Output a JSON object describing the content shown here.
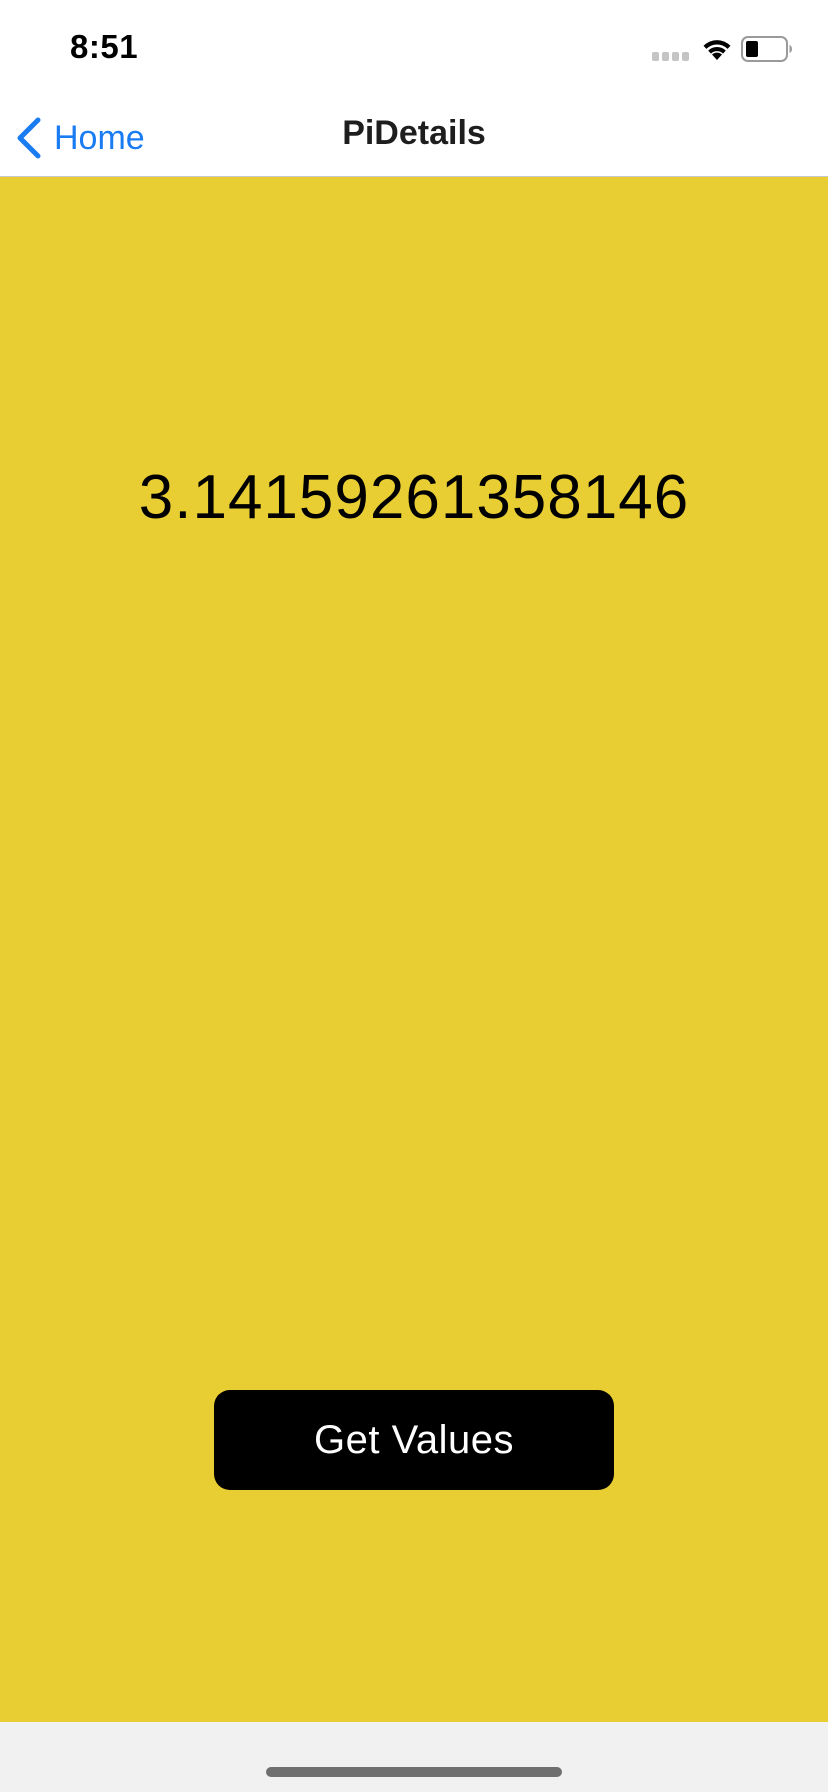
{
  "status_bar": {
    "time": "8:51",
    "icons": [
      "signal-icon",
      "wifi-icon",
      "battery-icon"
    ]
  },
  "nav_bar": {
    "back_label": "Home",
    "title": "PiDetails"
  },
  "content": {
    "pi_value": "3.14159261358146",
    "get_values_label": "Get Values"
  },
  "colors": {
    "accent": "#1a7cf3",
    "background": "#e8cd33",
    "button": "#000000",
    "button_text": "#ffffff"
  }
}
